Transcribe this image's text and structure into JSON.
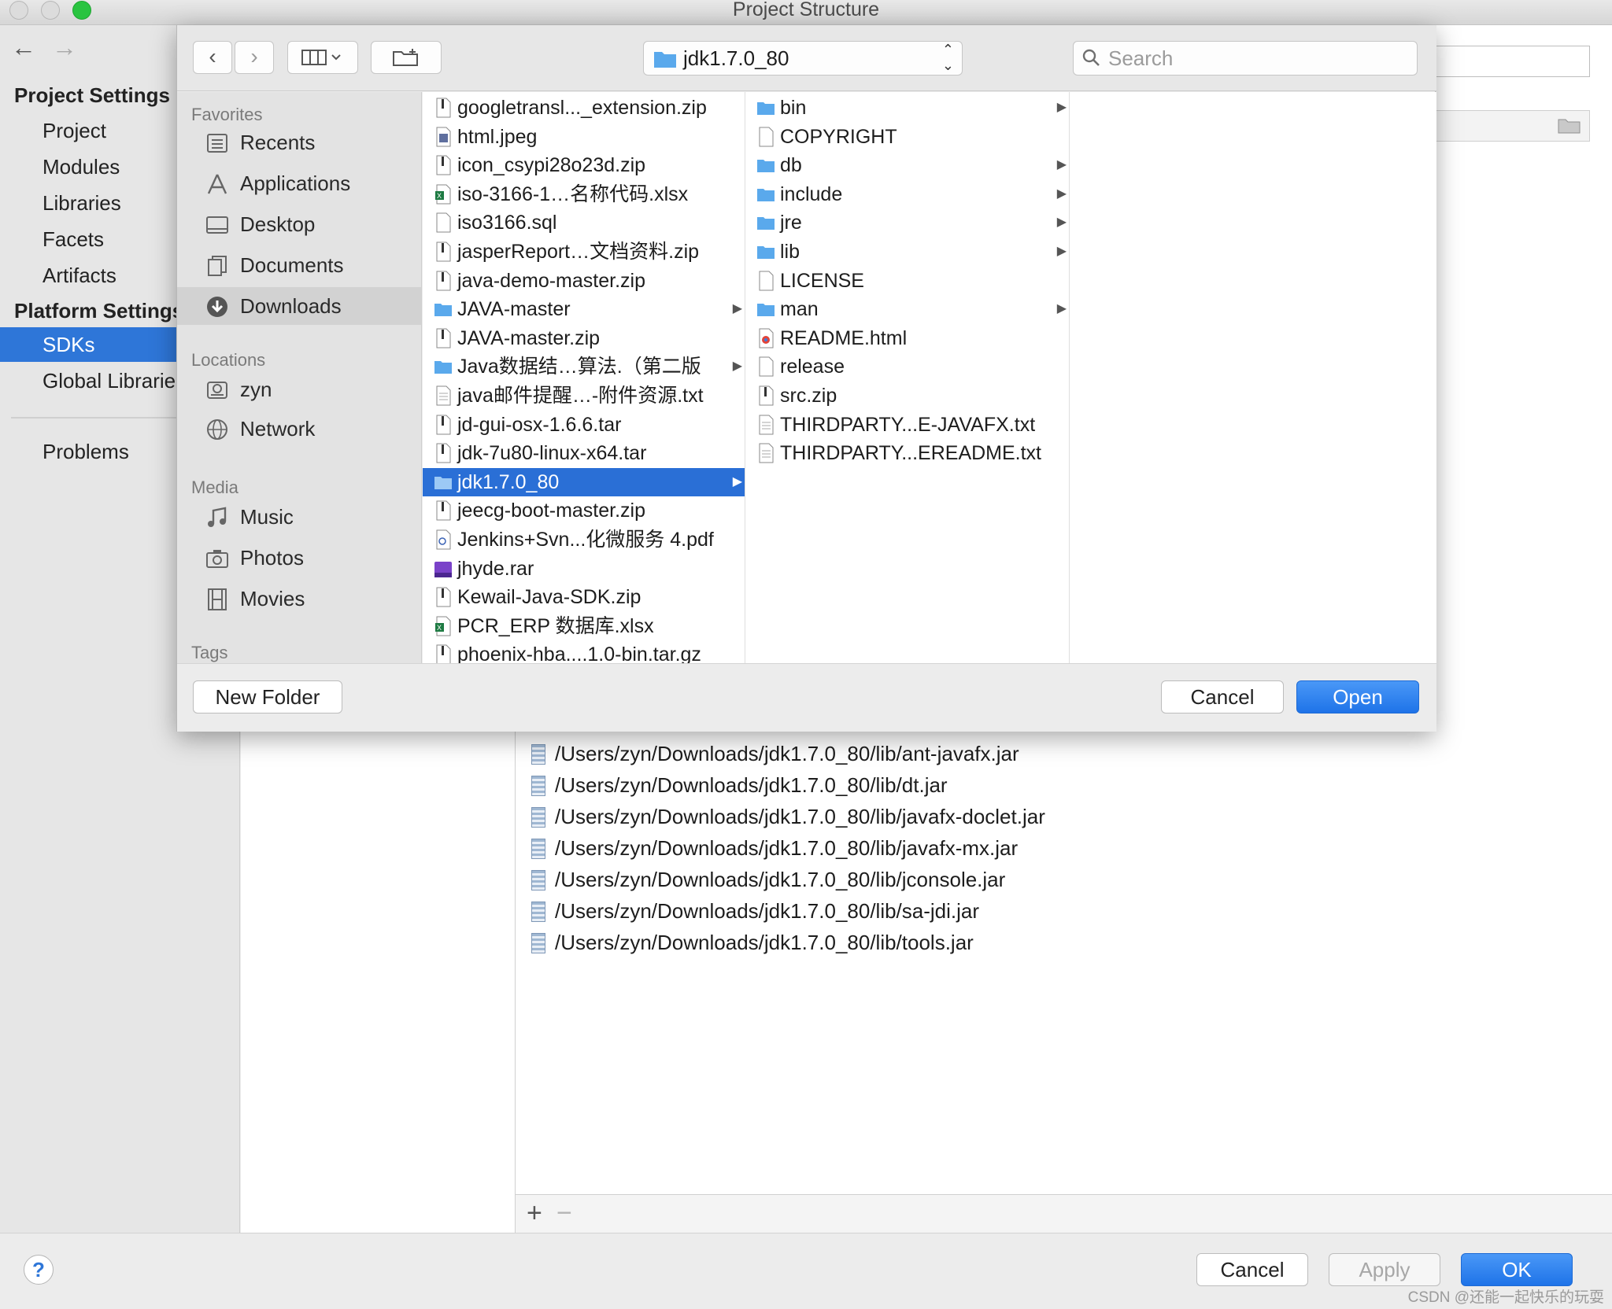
{
  "window": {
    "title": "Project Structure"
  },
  "sidebar": {
    "project_settings_heading": "Project Settings",
    "project_items": [
      {
        "label": "Project"
      },
      {
        "label": "Modules"
      },
      {
        "label": "Libraries"
      },
      {
        "label": "Facets"
      },
      {
        "label": "Artifacts"
      }
    ],
    "platform_settings_heading": "Platform Settings",
    "platform_items": [
      {
        "label": "SDKs",
        "selected": true
      },
      {
        "label": "Global Libraries"
      }
    ],
    "problems_label": "Problems"
  },
  "classpath": {
    "paths": [
      "/Users/zyn/Downloads/jdk1.7.0_80/lib/ant-javafx.jar",
      "/Users/zyn/Downloads/jdk1.7.0_80/lib/dt.jar",
      "/Users/zyn/Downloads/jdk1.7.0_80/lib/javafx-doclet.jar",
      "/Users/zyn/Downloads/jdk1.7.0_80/lib/javafx-mx.jar",
      "/Users/zyn/Downloads/jdk1.7.0_80/lib/jconsole.jar",
      "/Users/zyn/Downloads/jdk1.7.0_80/lib/sa-jdi.jar",
      "/Users/zyn/Downloads/jdk1.7.0_80/lib/tools.jar"
    ],
    "add_symbol": "+",
    "remove_symbol": "−"
  },
  "footer": {
    "help_label": "?",
    "cancel_label": "Cancel",
    "apply_label": "Apply",
    "ok_label": "OK",
    "watermark": "CSDN @还能一起快乐的玩耍"
  },
  "dialog": {
    "location": "jdk1.7.0_80",
    "search_placeholder": "Search",
    "favorites_heading": "Favorites",
    "favorites": [
      {
        "label": "Recents",
        "icon": "recents-icon"
      },
      {
        "label": "Applications",
        "icon": "applications-icon"
      },
      {
        "label": "Desktop",
        "icon": "desktop-icon"
      },
      {
        "label": "Documents",
        "icon": "documents-icon"
      },
      {
        "label": "Downloads",
        "icon": "downloads-icon",
        "selected": true
      }
    ],
    "locations_heading": "Locations",
    "locations": [
      {
        "label": "zyn",
        "icon": "disk-icon"
      },
      {
        "label": "Network",
        "icon": "network-icon"
      }
    ],
    "media_heading": "Media",
    "media": [
      {
        "label": "Music",
        "icon": "music-icon"
      },
      {
        "label": "Photos",
        "icon": "camera-icon"
      },
      {
        "label": "Movies",
        "icon": "film-icon"
      }
    ],
    "tags_heading": "Tags",
    "downloads_files": [
      {
        "name": "googletransl..._extension.zip",
        "type": "zip"
      },
      {
        "name": "html.jpeg",
        "type": "image"
      },
      {
        "name": "icon_csypi28o23d.zip",
        "type": "zip"
      },
      {
        "name": "iso-3166-1…名称代码.xlsx",
        "type": "excel"
      },
      {
        "name": "iso3166.sql",
        "type": "doc"
      },
      {
        "name": "jasperReport…文档资料.zip",
        "type": "zip"
      },
      {
        "name": "java-demo-master.zip",
        "type": "zip"
      },
      {
        "name": "JAVA-master",
        "type": "folder"
      },
      {
        "name": "JAVA-master.zip",
        "type": "zip"
      },
      {
        "name": "Java数据结…算法.（第二版",
        "type": "folder"
      },
      {
        "name": "java邮件提醒…-附件资源.txt",
        "type": "text"
      },
      {
        "name": "jd-gui-osx-1.6.6.tar",
        "type": "zip"
      },
      {
        "name": "jdk-7u80-linux-x64.tar",
        "type": "zip"
      },
      {
        "name": "jdk1.7.0_80",
        "type": "folder",
        "selected": true
      },
      {
        "name": "jeecg-boot-master.zip",
        "type": "zip"
      },
      {
        "name": "Jenkins+Svn...化微服务 4.pdf",
        "type": "pdf"
      },
      {
        "name": "jhyde.rar",
        "type": "rar"
      },
      {
        "name": "Kewail-Java-SDK.zip",
        "type": "zip"
      },
      {
        "name": "PCR_ERP 数据库.xlsx",
        "type": "excel"
      },
      {
        "name": "phoenix-hba....1.0-bin.tar.gz",
        "type": "zip"
      }
    ],
    "jdk_files": [
      {
        "name": "bin",
        "type": "folder"
      },
      {
        "name": "COPYRIGHT",
        "type": "doc"
      },
      {
        "name": "db",
        "type": "folder"
      },
      {
        "name": "include",
        "type": "folder"
      },
      {
        "name": "jre",
        "type": "folder"
      },
      {
        "name": "lib",
        "type": "folder"
      },
      {
        "name": "LICENSE",
        "type": "doc"
      },
      {
        "name": "man",
        "type": "folder"
      },
      {
        "name": "README.html",
        "type": "html"
      },
      {
        "name": "release",
        "type": "doc"
      },
      {
        "name": "src.zip",
        "type": "zip"
      },
      {
        "name": "THIRDPARTY...E-JAVAFX.txt",
        "type": "text"
      },
      {
        "name": "THIRDPARTY...EREADME.txt",
        "type": "text"
      }
    ],
    "new_folder_label": "New Folder",
    "cancel_label": "Cancel",
    "open_label": "Open"
  },
  "colors": {
    "accent": "#2e76d8",
    "selection": "#2a6fd6",
    "folder": "#5aa9ec"
  }
}
